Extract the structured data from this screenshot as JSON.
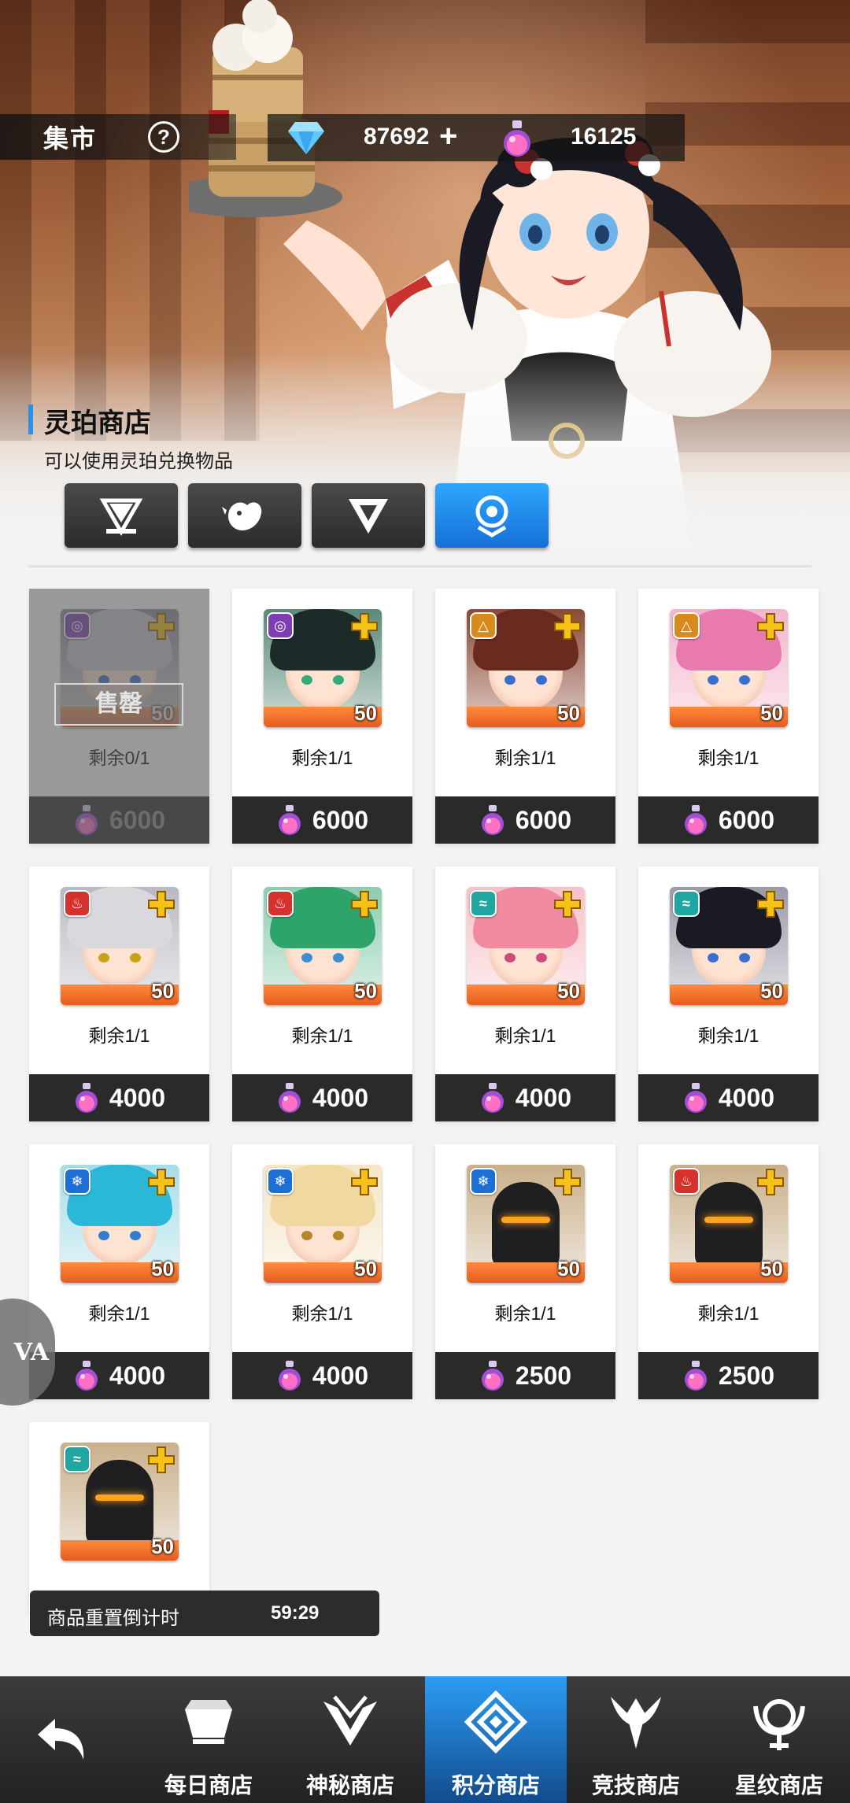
{
  "header": {
    "title": "集市",
    "help_icon": "question-circle-icon",
    "currencies": [
      {
        "icon": "diamond-icon",
        "value": "87692"
      },
      {
        "icon": "potion-icon",
        "value": "16125"
      }
    ]
  },
  "shop": {
    "name": "灵珀商店",
    "description": "可以使用灵珀兑换物品",
    "tabs": [
      {
        "icon": "crown-gem-icon",
        "active": false
      },
      {
        "icon": "rooster-icon",
        "active": false
      },
      {
        "icon": "wing-emblem-icon",
        "active": false
      },
      {
        "icon": "orb-emblem-icon",
        "active": true
      }
    ]
  },
  "items": [
    {
      "remain": "剩余0/1",
      "price": "6000",
      "level": "50",
      "element": "void",
      "sold_out": true,
      "sold_label": "售罄",
      "hair": "#c9c9d2",
      "bg": "#8a8aa0"
    },
    {
      "remain": "剩余1/1",
      "price": "6000",
      "level": "50",
      "element": "void",
      "hair": "#1d2a2a",
      "bg": "#5a8a78",
      "eye": "#2fae7a"
    },
    {
      "remain": "剩余1/1",
      "price": "6000",
      "level": "50",
      "element": "earth",
      "hair": "#6a2a1d",
      "bg": "#8a4a36",
      "eye": "#3a6fd0"
    },
    {
      "remain": "剩余1/1",
      "price": "6000",
      "level": "50",
      "element": "earth",
      "hair": "#e87ab0",
      "bg": "#f2b6cc",
      "eye": "#3a6fd0"
    },
    {
      "remain": "剩余1/1",
      "price": "4000",
      "level": "50",
      "element": "fire",
      "hair": "#d8d8dd",
      "bg": "#b9b9c2",
      "eye": "#c9a21a"
    },
    {
      "remain": "剩余1/1",
      "price": "4000",
      "level": "50",
      "element": "fire",
      "hair": "#2fa46a",
      "bg": "#8ccdb0",
      "eye": "#3a8fd0"
    },
    {
      "remain": "剩余1/1",
      "price": "4000",
      "level": "50",
      "element": "water",
      "hair": "#f08aa0",
      "bg": "#f6c2c8",
      "eye": "#d04a7a"
    },
    {
      "remain": "剩余1/1",
      "price": "4000",
      "level": "50",
      "element": "water",
      "hair": "#1a1a22",
      "bg": "#9a9aa8",
      "eye": "#3a6fd0"
    },
    {
      "remain": "剩余1/1",
      "price": "4000",
      "level": "50",
      "element": "ice",
      "hair": "#2bb8d8",
      "bg": "#a6dde8",
      "eye": "#2f7fd0"
    },
    {
      "remain": "剩余1/1",
      "price": "4000",
      "level": "50",
      "element": "ice",
      "hair": "#f0d9a0",
      "bg": "#f4e6c6",
      "eye": "#b8872a"
    },
    {
      "remain": "剩余1/1",
      "price": "2500",
      "level": "50",
      "element": "ice",
      "mech": true,
      "bg": "#c9b08a"
    },
    {
      "remain": "剩余1/1",
      "price": "2500",
      "level": "50",
      "element": "fire",
      "mech": true,
      "bg": "#c9b08a"
    },
    {
      "remain": "",
      "price": "",
      "level": "50",
      "element": "water",
      "mech": true,
      "bg": "#c9b08a",
      "partial": true
    }
  ],
  "countdown": {
    "label": "商品重置倒计时",
    "time": "59:29"
  },
  "floating_button": {
    "text": "VA"
  },
  "bottom_nav": {
    "back_icon": "back-arrow-icon",
    "items": [
      {
        "label": "每日商店",
        "icon": "gem-crown-icon",
        "active": false
      },
      {
        "label": "神秘商店",
        "icon": "winged-emblem-icon",
        "active": false
      },
      {
        "label": "积分商店",
        "icon": "diamond-knot-icon",
        "active": true
      },
      {
        "label": "竞技商店",
        "icon": "horned-emblem-icon",
        "active": false
      },
      {
        "label": "星纹商店",
        "icon": "star-crest-icon",
        "active": false
      }
    ]
  },
  "colors": {
    "accent": "#2f8ee5",
    "active_tab": "#1e8bf0",
    "price_bar": "#2a2a2a",
    "fire": "#d7312e",
    "void": "#7b3fb3",
    "earth": "#d98a1c",
    "water": "#1fa6a0",
    "ice": "#1d6fd3"
  }
}
